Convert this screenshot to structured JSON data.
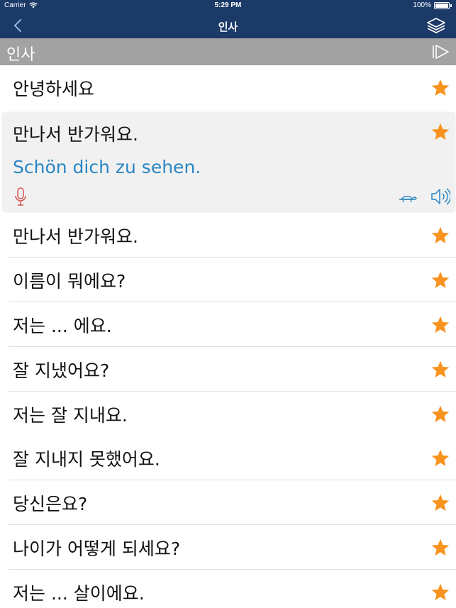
{
  "status_bar": {
    "carrier": "Carrier",
    "time": "5:29 PM",
    "battery": "100%",
    "battery_level": 1.0
  },
  "nav_bar": {
    "title": "인사",
    "back_icon": "chevron-left-icon",
    "layers_icon": "layers-icon"
  },
  "section_header": {
    "label": "인사",
    "play_icon": "play-all-icon"
  },
  "colors": {
    "nav_background": "#1b3a68",
    "section_background": "#a2a2a2",
    "star": "#f7931e",
    "translation_text": "#2a86c2",
    "mic": "#d9534f",
    "control_icons": "#2a86c2"
  },
  "phrases": [
    {
      "text": "안녕하세요",
      "favorite": true
    },
    {
      "text": "만나서 반가워요.",
      "favorite": true,
      "expanded": true,
      "translation": "Schön dich zu sehen."
    },
    {
      "text": "만나서 반가워요.",
      "favorite": true
    },
    {
      "text": "이름이 뭐에요?",
      "favorite": true
    },
    {
      "text": "저는 ... 에요.",
      "favorite": true
    },
    {
      "text": "잘 지냈어요?",
      "favorite": true
    },
    {
      "text": "저는 잘 지내요.",
      "favorite": true
    },
    {
      "text": "잘 지내지 못했어요.",
      "favorite": true
    },
    {
      "text": "당신은요?",
      "favorite": true
    },
    {
      "text": "나이가 어떻게 되세요?",
      "favorite": true
    },
    {
      "text": "저는 ... 살이에요.",
      "favorite": true
    }
  ]
}
